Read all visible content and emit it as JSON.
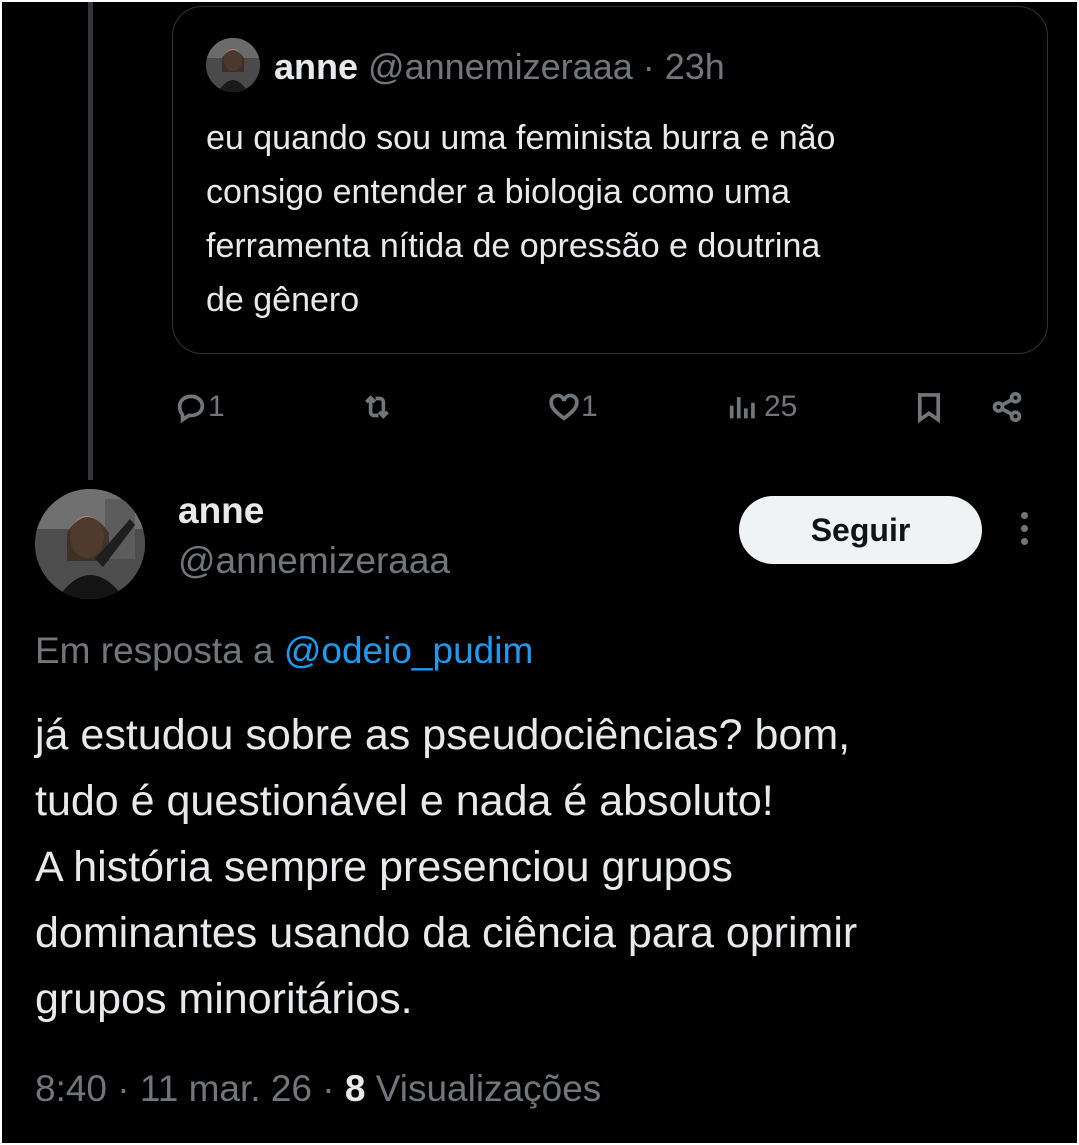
{
  "quoted": {
    "name": "anne",
    "handle": "@annemizeraaa",
    "time": "23h",
    "text": "eu quando sou uma feminista burra e não\nconsigo entender a biologia como uma\nferramenta nítida de opressão e doutrina\nde gênero"
  },
  "actions": {
    "reply_count": "1",
    "like_count": "1",
    "views_count": "25"
  },
  "tweet": {
    "name": "anne",
    "handle": "@annemizeraaa",
    "follow_label": "Seguir",
    "reply_prefix": "Em resposta a",
    "reply_mention": "@odeio_pudim",
    "text": "já estudou sobre as pseudociências? bom,\ntudo é questionável e nada é absoluto!\nA história sempre presenciou grupos\ndominantes usando da ciência para oprimir\ngrupos minoritários.",
    "time": "8:40",
    "date": "11 mar. 26",
    "views_count": "8",
    "views_label": "Visualizações"
  },
  "colors": {
    "background": "#000000",
    "text_primary": "#e7e9ea",
    "text_secondary": "#71767b",
    "link": "#1d9bf0",
    "border": "#2f3336"
  }
}
